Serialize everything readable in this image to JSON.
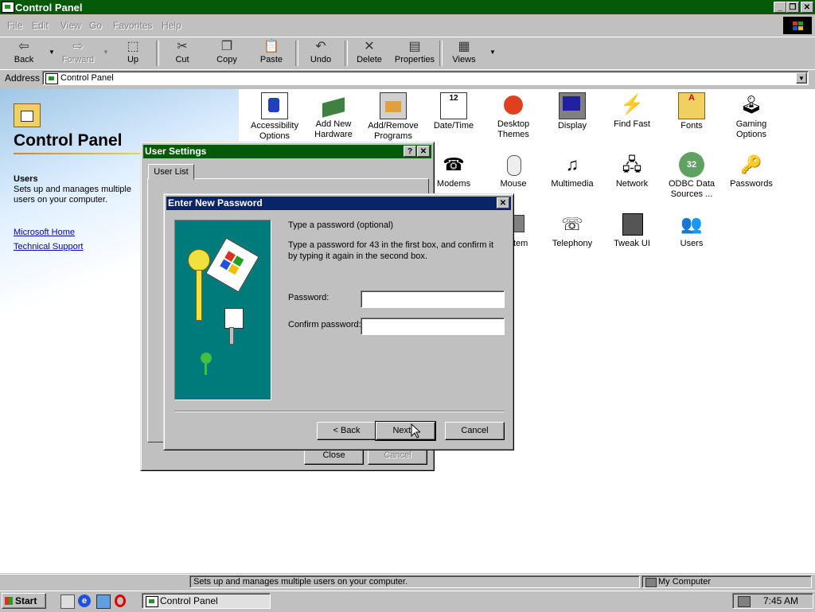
{
  "window": {
    "title": "Control Panel"
  },
  "menu": [
    "File",
    "Edit",
    "View",
    "Go",
    "Favorites",
    "Help"
  ],
  "toolbar": {
    "back": "Back",
    "forward": "Forward",
    "up": "Up",
    "cut": "Cut",
    "copy": "Copy",
    "paste": "Paste",
    "undo": "Undo",
    "delete": "Delete",
    "properties": "Properties",
    "views": "Views"
  },
  "address": {
    "label": "Address",
    "value": "Control Panel"
  },
  "left": {
    "title": "Control Panel",
    "item_title": "Users",
    "item_desc": "Sets up and manages multiple users on your computer.",
    "link1": "Microsoft Home",
    "link2": "Technical Support"
  },
  "icons": {
    "accessibility": "Accessibility Options",
    "addhw": "Add New Hardware",
    "addremove": "Add/Remove Programs",
    "datetime": "Date/Time",
    "desktop": "Desktop Themes",
    "display": "Display",
    "findfast": "Find Fast",
    "fonts": "Fonts",
    "gaming": "Gaming Options",
    "modems": "Modems",
    "mouse": "Mouse",
    "multimedia": "Multimedia",
    "network": "Network",
    "odbc": "ODBC Data Sources ...",
    "passwords": "Passwords",
    "system": "System",
    "telephony": "Telephony",
    "tweakui": "Tweak UI",
    "users": "Users"
  },
  "user_settings": {
    "title": "User Settings",
    "tab": "User List",
    "close": "Close",
    "cancel": "Cancel",
    "help": "?",
    "x": "✕"
  },
  "password_dialog": {
    "title": "Enter New Password",
    "heading": "Type a password (optional)",
    "instructions": "Type a password for 43 in the first box, and confirm it by typing it again in the second box.",
    "password_label": "Password:",
    "password_value": "",
    "confirm_label": "Confirm password:",
    "confirm_value": "",
    "back": "< Back",
    "next": "Next >",
    "cancel": "Cancel",
    "x": "✕"
  },
  "status": {
    "message": "Sets up and manages multiple users on your computer.",
    "zone": "My Computer"
  },
  "taskbar": {
    "start": "Start",
    "task": "Control Panel",
    "time": "7:45 AM"
  }
}
